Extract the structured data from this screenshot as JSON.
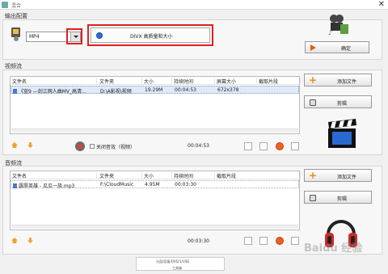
{
  "window": {
    "title": "混合",
    "close_glyph": "✕"
  },
  "output": {
    "group_label": "输出配置",
    "format_value": "MP4",
    "quality_label": "DIVX 高质量和大小",
    "confirm_label": "确定"
  },
  "video": {
    "group_label": "视频流",
    "columns": [
      "文件名",
      "文件夹",
      "大小",
      "持续时间",
      "屏幕大小",
      "截取片段"
    ],
    "rows": [
      {
        "name": "《宣9 —剑三网人曲MV_高清…",
        "folder": "D:\\A影视\\视频",
        "size": "19.29M",
        "duration": "00:04:53",
        "screen": "672x378",
        "clip": ""
      }
    ],
    "add_label": "添加文件",
    "edit_label": "剪辑",
    "mute_label": "关闭音效（视频）",
    "total_time": "00:04:53"
  },
  "audio": {
    "group_label": "音频流",
    "columns": [
      "文件名",
      "文件夹",
      "大小",
      "持续时间",
      "截取片段"
    ],
    "rows": [
      {
        "name": "霹雳英雄 - 瓜瓜一族.mp3",
        "folder": "F:\\CloudMusic",
        "size": "4.95M",
        "duration": "00:03:30",
        "clip": ""
      }
    ],
    "add_label": "添加文件",
    "edit_label": "剪辑",
    "total_time": "00:03:30"
  },
  "status": {
    "line1": "光盘/容量/DVD/1/USB",
    "line2": "工具箱"
  },
  "watermark": "Baidu 经验",
  "colors": {
    "highlight": "#e02020",
    "accent": "#f08a10",
    "selection": "#dfe9f7"
  }
}
